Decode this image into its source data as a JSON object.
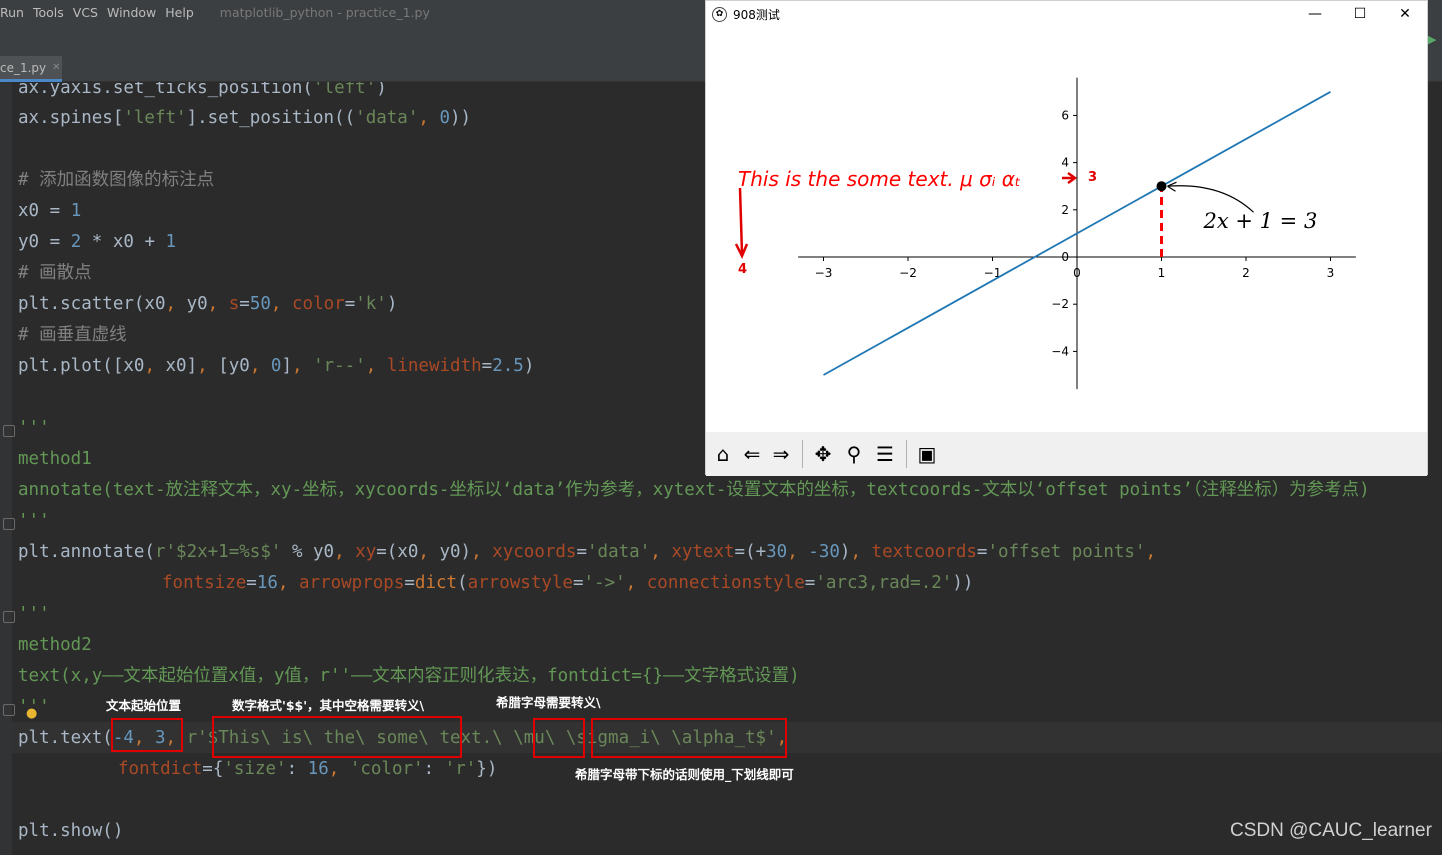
{
  "menu": {
    "items": [
      "Run",
      "Tools",
      "VCS",
      "Window",
      "Help"
    ],
    "project_title": "matplotlib_python - practice_1.py"
  },
  "tab": {
    "label": "ce_1.py",
    "close": "✕"
  },
  "code": {
    "l1": [
      "ax.yaxis.set_ticks_position(",
      "'left'",
      ")"
    ],
    "l2": [
      "ax.spines[",
      "'left'",
      "].set_position((",
      "'data'",
      ", ",
      "0",
      "))"
    ],
    "l3": "# 添加函数图像的标注点",
    "l4": [
      "x0 = ",
      "1"
    ],
    "l5": [
      "y0 = ",
      "2",
      " * x0 + ",
      "1"
    ],
    "l6": "# 画散点",
    "l7": [
      "plt.scatter(x0",
      ", ",
      "y0",
      ", ",
      "s",
      "=",
      "50",
      ", ",
      "color",
      "=",
      "'k'",
      ")"
    ],
    "l8": "# 画垂直虚线",
    "l9": [
      "plt.plot([x0",
      ", ",
      "x0]",
      ", ",
      "[y0",
      ", ",
      "0",
      "]",
      ", ",
      "'r--'",
      ", ",
      "linewidth",
      "=",
      "2.5",
      ")"
    ],
    "l10": "'''",
    "l11": "method1",
    "l12": "annotate(text-放注释文本，xy-坐标，xycoords-坐标以‘data’作为参考，xytext-设置文本的坐标，textcoords-文本以‘offset points’（注释坐标）为参考点)",
    "l13": "'''",
    "l14": [
      "plt.annotate(",
      "r'$2x+1=%s$'",
      " % y0",
      ", ",
      "xy",
      "=(x0",
      ", ",
      "y0)",
      ", ",
      "xycoords",
      "=",
      "'data'",
      ", ",
      "xytext",
      "=(+",
      "30",
      ", ",
      "-30",
      ")",
      ", ",
      "textcoords",
      "=",
      "'offset points'",
      ","
    ],
    "l15": [
      "fontsize",
      "=",
      "16",
      ", ",
      "arrowprops",
      "=",
      "dict",
      "(",
      "arrowstyle",
      "=",
      "'->'",
      ", ",
      "connectionstyle",
      "=",
      "'arc3,rad=.2'",
      "))"
    ],
    "l16": "'''",
    "l17": "method2",
    "l18": "text(x,y——文本起始位置x值，y值，r''——文本内容正则化表达，fontdict={}——文字格式设置)",
    "l19": "'''",
    "l20": [
      "plt.text(",
      "-4",
      ", ",
      "3",
      ", ",
      "r'$This\\ is\\ the\\ some\\ text.\\ \\mu\\ \\sigma_i\\ \\alpha_t$'",
      ","
    ],
    "l21": [
      "fontdict",
      "={",
      "'size'",
      ": ",
      "16",
      ", ",
      "'color'",
      ": ",
      "'r'",
      "})"
    ],
    "l22": "plt.show()"
  },
  "annotations": {
    "text_start": "文本起始位置",
    "math_format": "数字格式'$$'，其中空格需要转义\\",
    "greek_escape": "希腊字母需要转义\\",
    "greek_subscript": "希腊字母带下标的话则使用_下划线即可"
  },
  "watermark": "CSDN @CAUC_learner",
  "figure_window": {
    "title": "908测试",
    "minimize": "—",
    "maximize": "☐",
    "close": "✕",
    "toolbar_icons": [
      "home-icon",
      "back-icon",
      "forward-icon",
      "pan-icon",
      "zoom-icon",
      "configure-subplots-icon",
      "save-icon"
    ]
  },
  "chart_data": {
    "type": "line",
    "series": [
      {
        "x": [
          -3,
          3
        ],
        "y": [
          -5,
          7
        ],
        "color": "#1f77b4"
      }
    ],
    "scatter_point": {
      "x": 1,
      "y": 3,
      "color": "#000000"
    },
    "vline": {
      "x": 1,
      "y_from": 0,
      "y_to": 3,
      "color": "#ff0000",
      "style": "dashed"
    },
    "xticks": [
      -3,
      -2,
      -1,
      0,
      1,
      2,
      3
    ],
    "yticks": [
      -4,
      -2,
      0,
      2,
      4,
      6
    ],
    "xlim": [
      -3.3,
      3.3
    ],
    "ylim": [
      -5.6,
      7.6
    ],
    "spines": "centered at origin",
    "annotation": {
      "text": "2x + 1 = 3",
      "xy": [
        1,
        3
      ]
    },
    "text": {
      "content": "This is the some text. μ σᵢ αₜ",
      "at": [
        -4,
        3
      ],
      "color": "#ff0000"
    },
    "markers": [
      {
        "label": "3"
      },
      {
        "label": "4"
      }
    ]
  }
}
